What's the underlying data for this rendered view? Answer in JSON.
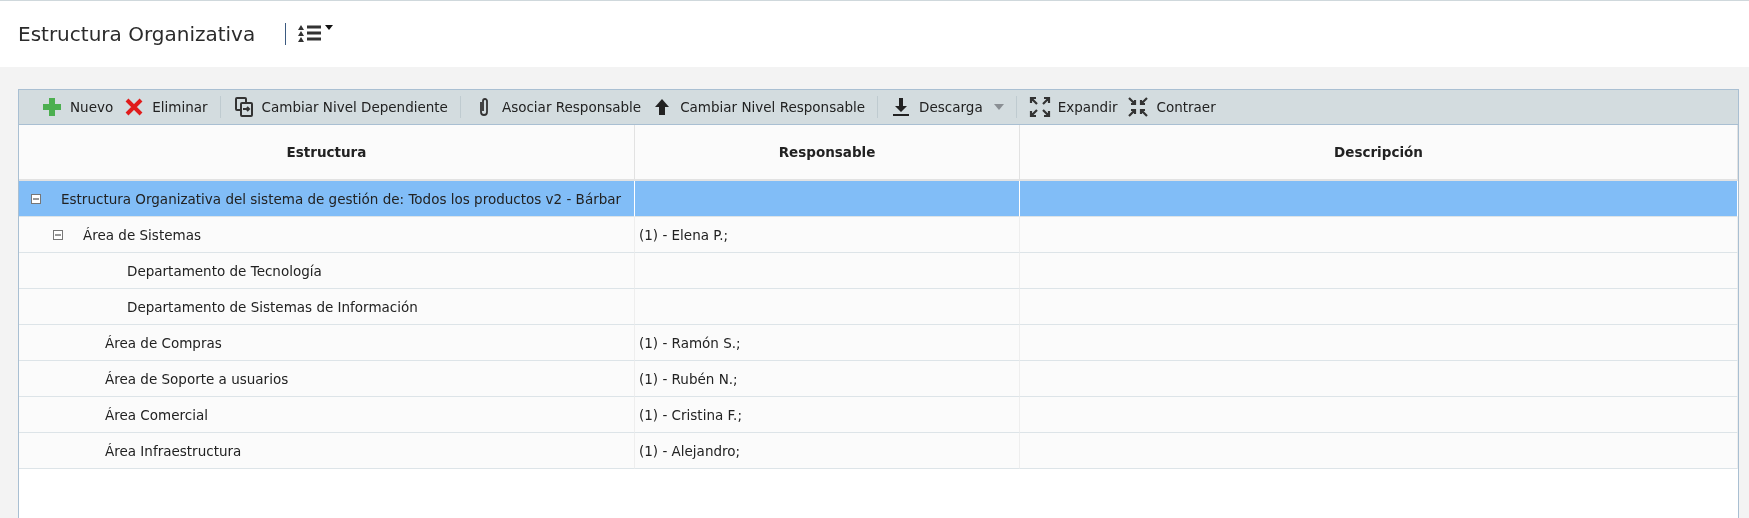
{
  "header": {
    "title": "Estructura Organizativa"
  },
  "toolbar": {
    "groups": [
      [
        {
          "kind": "add",
          "label": "Nuevo"
        },
        {
          "kind": "delete",
          "label": "Eliminar"
        }
      ],
      [
        {
          "kind": "move",
          "label": "Cambiar Nivel Dependiente"
        }
      ],
      [
        {
          "kind": "attach",
          "label": "Asociar Responsable"
        },
        {
          "kind": "up",
          "label": "Cambiar Nivel Responsable"
        }
      ],
      [
        {
          "kind": "download",
          "label": "Descarga",
          "dropdown": true
        }
      ],
      [
        {
          "kind": "expand",
          "label": "Expandir"
        },
        {
          "kind": "collapse",
          "label": "Contraer"
        }
      ]
    ]
  },
  "table": {
    "columns": [
      "Estructura",
      "Responsable",
      "Descripción"
    ],
    "rows": [
      {
        "name": "Estructura Organizativa del sistema de gestión de: Todos los productos v2 - Bárbar",
        "selected": true,
        "expanded": true,
        "children": [
          {
            "name": "Área de Sistemas",
            "responsable": "(1) - Elena P.;",
            "selected": false,
            "expanded": true,
            "children": [
              {
                "name": "Departamento de Tecnología",
                "selected": false
              },
              {
                "name": "Departamento de Sistemas de Información",
                "selected": false
              }
            ]
          },
          {
            "name": "Área de Compras",
            "responsable": "(1) - Ramón S.;",
            "selected": false
          },
          {
            "name": "Área de Soporte a usuarios",
            "responsable": "(1) - Rubén N.;",
            "selected": false
          },
          {
            "name": "Área Comercial",
            "responsable": "(1) - Cristina F.;",
            "selected": false
          },
          {
            "name": "Área Infraestructura",
            "responsable": "(1) - Alejandro;",
            "selected": false
          }
        ]
      }
    ]
  }
}
